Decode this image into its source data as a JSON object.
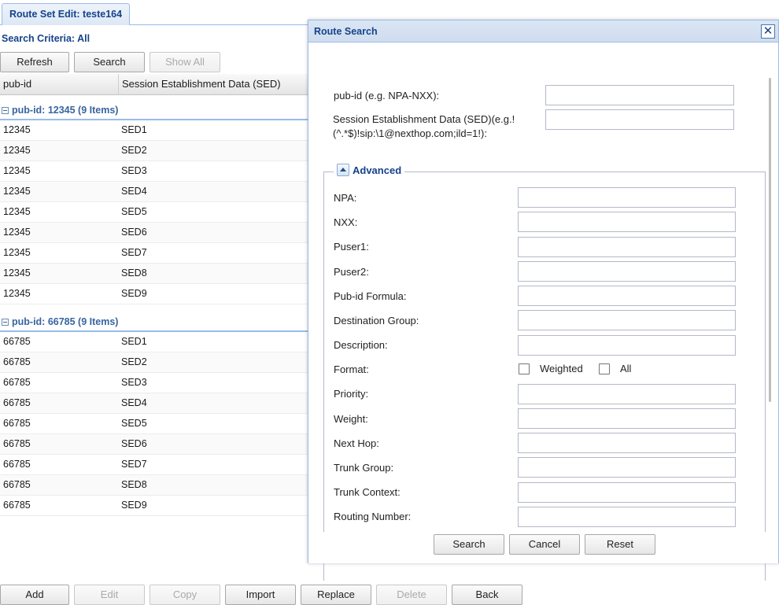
{
  "tab": {
    "title": "Route Set Edit: teste164"
  },
  "criteria": {
    "label": "Search Criteria: All"
  },
  "toolbar": {
    "refresh": "Refresh",
    "search": "Search",
    "show_all": "Show All"
  },
  "grid": {
    "columns": [
      "pub-id",
      "Session Establishment Data (SED)"
    ],
    "groups": [
      {
        "header": "pub-id: 12345 (9 Items)",
        "rows": [
          [
            "12345",
            "SED1"
          ],
          [
            "12345",
            "SED2"
          ],
          [
            "12345",
            "SED3"
          ],
          [
            "12345",
            "SED4"
          ],
          [
            "12345",
            "SED5"
          ],
          [
            "12345",
            "SED6"
          ],
          [
            "12345",
            "SED7"
          ],
          [
            "12345",
            "SED8"
          ],
          [
            "12345",
            "SED9"
          ]
        ]
      },
      {
        "header": "pub-id: 66785 (9 Items)",
        "rows": [
          [
            "66785",
            "SED1"
          ],
          [
            "66785",
            "SED2"
          ],
          [
            "66785",
            "SED3"
          ],
          [
            "66785",
            "SED4"
          ],
          [
            "66785",
            "SED5"
          ],
          [
            "66785",
            "SED6"
          ],
          [
            "66785",
            "SED7"
          ],
          [
            "66785",
            "SED8"
          ],
          [
            "66785",
            "SED9"
          ]
        ]
      }
    ]
  },
  "bottom_toolbar": {
    "add": "Add",
    "edit": "Edit",
    "copy": "Copy",
    "import": "Import",
    "replace": "Replace",
    "delete": "Delete",
    "back": "Back"
  },
  "dialog": {
    "title": "Route Search",
    "close_symbol": "✕",
    "pubid_label": "pub-id (e.g. NPA-NXX):",
    "pubid_value": "",
    "sed_label_line1": "Session Establishment Data (SED)(e.g.!",
    "sed_label_line2": "(^.*$)!sip:\\1@nexthop.com;ild=1!):",
    "sed_value": "",
    "advanced_label": "Advanced",
    "advanced_fields": [
      "NPA:",
      "NXX:",
      "Puser1:",
      "Puser2:",
      "Pub-id Formula:",
      "Destination Group:",
      "Description:",
      "Format:",
      "Priority:",
      "Weight:",
      "Next Hop:",
      "Trunk Group:",
      "Trunk Context:",
      "Routing Number:"
    ],
    "format_options": {
      "weighted": "Weighted",
      "all": "All"
    },
    "buttons": {
      "search": "Search",
      "cancel": "Cancel",
      "reset": "Reset"
    }
  },
  "colors": {
    "accent": "#15428b",
    "border": "#99bbe8",
    "header_bg": "#dae6f4"
  }
}
